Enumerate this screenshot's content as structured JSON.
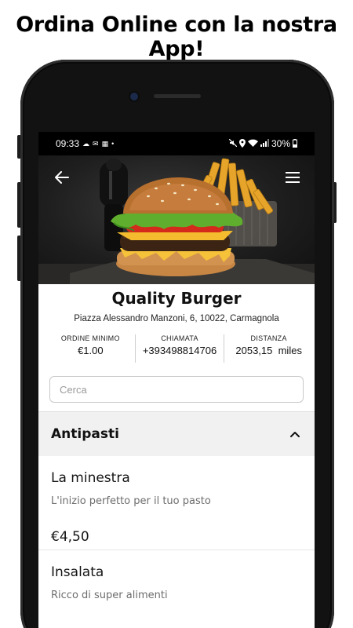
{
  "promo": {
    "headline": "Ordina Online con la nostra App!"
  },
  "status_bar": {
    "time": "09:33",
    "battery": "30%",
    "icons_left": [
      "weather-icon",
      "email-icon",
      "image-icon",
      "dot-icon"
    ],
    "icons_right": [
      "mute-icon",
      "location-icon",
      "wifi-icon",
      "signal-icon",
      "battery-icon"
    ]
  },
  "header": {
    "back_icon": "arrow-left-icon",
    "menu_icon": "hamburger-menu-icon",
    "hero_image": "burger-and-fries-photo"
  },
  "restaurant": {
    "name": "Quality Burger",
    "address": "Piazza Alessandro Manzoni, 6, 10022, Carmagnola"
  },
  "stats": [
    {
      "label": "ORDINE MINIMO",
      "value": "€1.00"
    },
    {
      "label": "CHIAMATA",
      "value": "+393498814706"
    },
    {
      "label": "DISTANZA",
      "value": "2053,15  miles"
    }
  ],
  "search": {
    "placeholder": "Cerca",
    "value": ""
  },
  "category": {
    "title": "Antipasti",
    "expanded": true,
    "chevron_icon": "chevron-up-icon"
  },
  "items": [
    {
      "name": "La minestra",
      "description": "L'inizio perfetto per il tuo pasto",
      "price": "€4,50"
    },
    {
      "name": "Insalata",
      "description": "Ricco di super alimenti"
    }
  ],
  "colors": {
    "phone_frame": "#121212",
    "status_bar": "#000000",
    "category_bg": "#f1f1f1",
    "description_text": "#6d6d6d"
  }
}
